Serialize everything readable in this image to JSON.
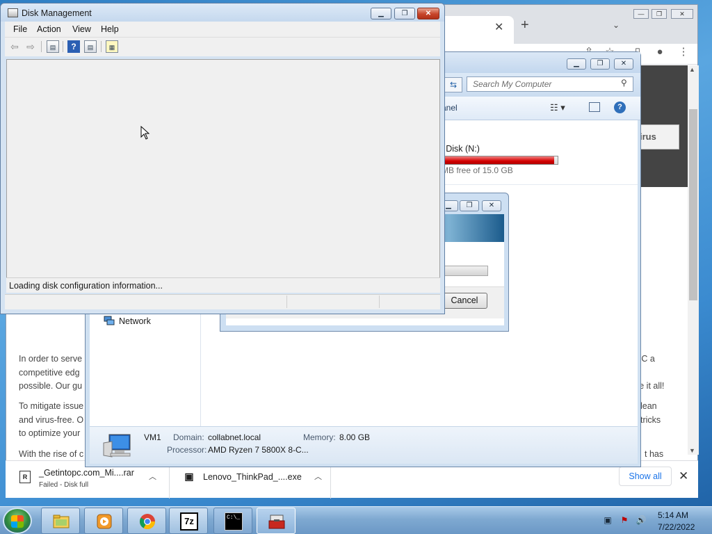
{
  "chrome": {
    "article_lines_left": [
      "In order to serve",
      "competitive edg",
      "possible. Our gu",
      "To mitigate issue",
      "and virus-free. O",
      "to optimize your",
      "With the rise of c"
    ],
    "article_lines_right": [
      "PC a",
      "ve it all!",
      "lean",
      "tricks",
      "t has"
    ],
    "virus_tab": "irus"
  },
  "downloads": {
    "items": [
      {
        "name": "_Getintopc.com_Mi....rar",
        "status": "Failed - Disk full",
        "icon": "R"
      },
      {
        "name": "Lenovo_ThinkPad_....exe",
        "status": ""
      }
    ],
    "show_all": "Show all"
  },
  "explorer": {
    "search_placeholder": "Search My Computer",
    "cmd_label": "anel",
    "disk_name": "l Disk (N:)",
    "disk_free": "MB free of 15.0 GB",
    "disk_used_fraction": 0.97,
    "nav_network": "Network",
    "computer_name": "VM1",
    "domain_label": "Domain:",
    "domain_value": "collabnet.local",
    "memory_label": "Memory:",
    "memory_value": "8.00 GB",
    "processor_label": "Processor:",
    "processor_value": "AMD Ryzen 7 5800X 8-C..."
  },
  "dialog": {
    "cancel_label": "Cancel"
  },
  "diskmgmt": {
    "title": "Disk Management",
    "menu": [
      "File",
      "Action",
      "View",
      "Help"
    ],
    "loading_text": "Loading disk configuration information..."
  },
  "taskbar": {
    "clock_time": "5:14 AM",
    "clock_date": "7/22/2022",
    "apps": [
      "explorer",
      "media-player",
      "chrome",
      "7-zip",
      "command-prompt",
      "toolbox"
    ],
    "sevenzip_label": "7z"
  }
}
